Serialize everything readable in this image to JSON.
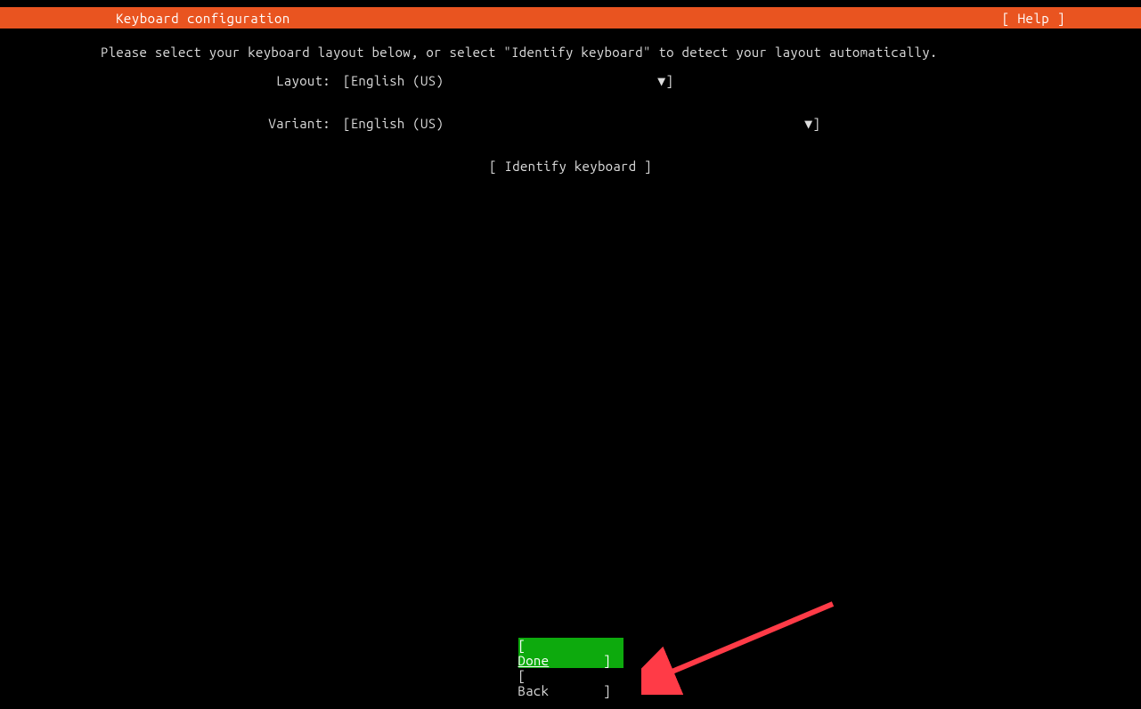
{
  "header": {
    "title": "Keyboard configuration",
    "help": "[ Help ]"
  },
  "instruction": "Please select your keyboard layout below, or select \"Identify keyboard\" to detect your layout automatically.",
  "form": {
    "layout_label": "Layout:",
    "layout_value": "English (US)",
    "variant_label": "Variant:",
    "variant_value": "English (US)"
  },
  "identify_button": "[ Identify keyboard ]",
  "footer": {
    "done": "Done",
    "back": "Back"
  }
}
